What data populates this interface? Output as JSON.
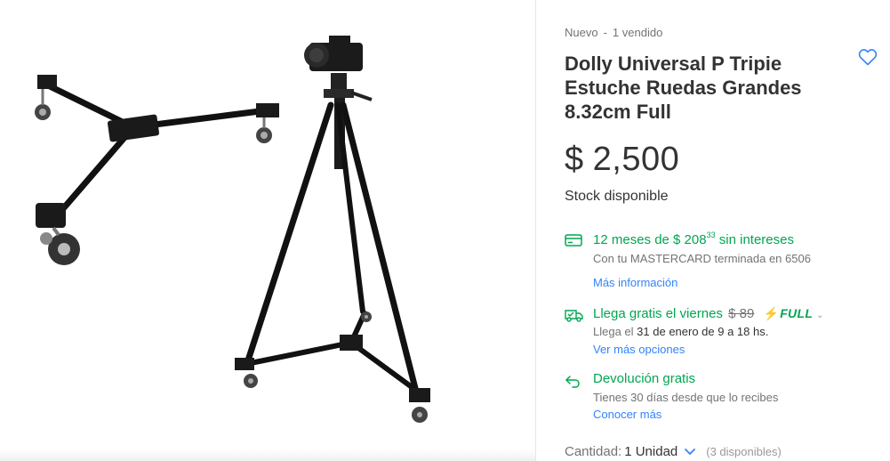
{
  "product": {
    "condition": "Nuevo",
    "separator": "-",
    "sold": "1 vendido",
    "title": "Dolly Universal P Tripie Estuche Ruedas Grandes 8.32cm Full",
    "price_currency": "$",
    "price_amount": "2,500",
    "stock": "Stock disponible"
  },
  "installments": {
    "icon": "credit-card-icon",
    "text_prefix": "12 meses de $ 208",
    "cents": "33",
    "text_suffix": "sin intereses",
    "card_info": "Con tu MASTERCARD terminada en 6506",
    "more_info": "Más información"
  },
  "shipping": {
    "icon": "truck-icon",
    "text": "Llega gratis el viernes",
    "old_price": "$ 89",
    "full_label": "FULL",
    "eta_prefix": "Llega el",
    "eta_date": "31 de enero de 9 a 18 hs.",
    "more_options": "Ver más opciones"
  },
  "returns": {
    "icon": "return-arrow-icon",
    "text": "Devolución gratis",
    "detail": "Tienes 30 días desde que lo recibes",
    "link": "Conocer más"
  },
  "quantity": {
    "label": "Cantidad:",
    "value": "1 Unidad",
    "available": "(3 disponibles)"
  },
  "colors": {
    "green": "#00a650",
    "blue": "#3483fa",
    "gray_text": "#737373",
    "dark_text": "#333333"
  },
  "gallery": {
    "image": "tripod-dolly-photo"
  }
}
